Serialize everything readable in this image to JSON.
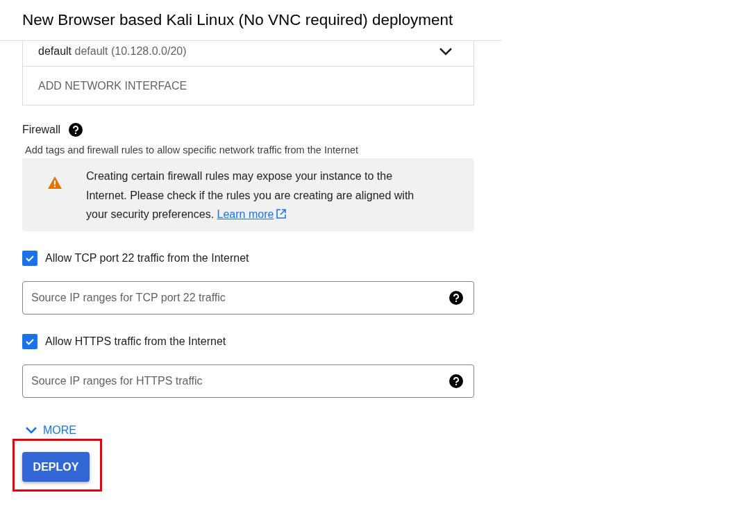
{
  "header": {
    "title": "New Browser based Kali Linux (No VNC required) deployment"
  },
  "network": {
    "name": "default",
    "detail": "default (10.128.0.0/20)",
    "add_label": "ADD NETWORK INTERFACE"
  },
  "firewall": {
    "label": "Firewall",
    "description": "Add tags and firewall rules to allow specific network traffic from the Internet",
    "notice": {
      "text": "Creating certain firewall rules may expose your instance to the Internet. Please check if the rules you are creating are aligned with your security preferences.",
      "link": "Learn more"
    },
    "rules": [
      {
        "label": "Allow TCP port 22 traffic from the Internet",
        "checked": true,
        "placeholder": "Source IP ranges for TCP port 22 traffic"
      },
      {
        "label": "Allow HTTPS traffic from the Internet",
        "checked": true,
        "placeholder": "Source IP ranges for HTTPS traffic"
      }
    ]
  },
  "more": {
    "label": "MORE"
  },
  "deploy": {
    "label": "DEPLOY",
    "highlighted": true
  }
}
